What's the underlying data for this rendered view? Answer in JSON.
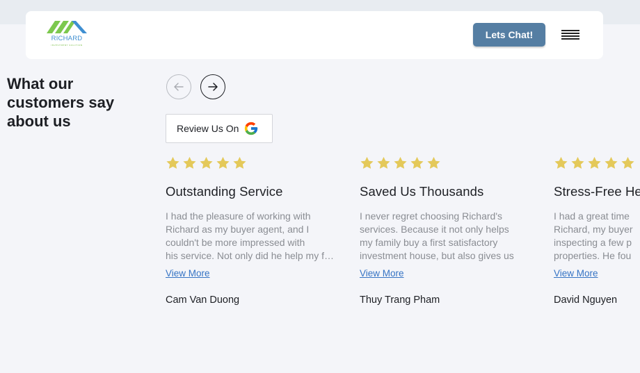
{
  "brand": {
    "name": "RICHARD",
    "tagline": "INVESTMENT SOLUTION"
  },
  "header": {
    "chat_label": "Lets Chat!"
  },
  "section": {
    "heading": "What our customers say about us"
  },
  "review_button": {
    "label": "Review Us On"
  },
  "colors": {
    "star": "#e4c95a",
    "button": "#557ea3",
    "link": "#3573c4"
  },
  "testimonials": [
    {
      "rating": 5,
      "title": "Outstanding Service",
      "lines": [
        "I had the pleasure of working with",
        "Richard as my buyer agent, and I",
        "couldn't be more impressed with",
        "his service. Not only did he help my family"
      ],
      "link": "View More",
      "author": "Cam Van Duong"
    },
    {
      "rating": 5,
      "title": "Saved Us Thousands",
      "lines": [
        "I never regret choosing Richard's",
        "services. Because it not only helps",
        "my family buy a first satisfactory",
        "investment house, but also gives us"
      ],
      "link": "View More",
      "author": "Thuy Trang Pham"
    },
    {
      "rating": 5,
      "title": "Stress-Free He",
      "lines": [
        "I had a great time",
        "Richard, my buyer",
        "inspecting a few p",
        "properties. He fou"
      ],
      "link": "View More",
      "author": "David Nguyen"
    }
  ]
}
